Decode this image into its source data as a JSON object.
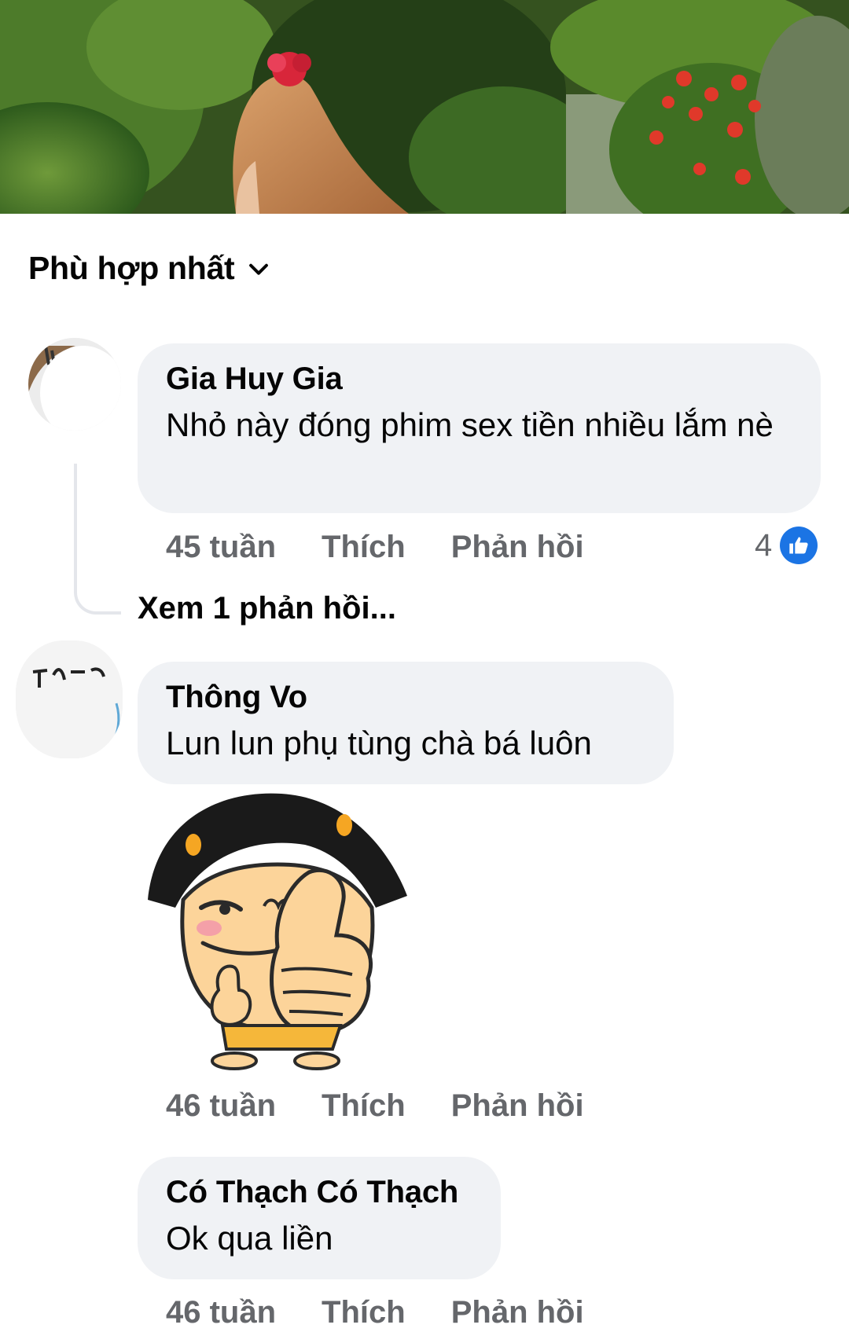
{
  "sort": {
    "label": "Phù hợp nhất"
  },
  "comments": [
    {
      "author": "Gia Huy Gia",
      "text": "Nhỏ này đóng phim sex tiền nhiều lắm nè",
      "time": "45 tuần",
      "like_label": "Thích",
      "reply_label": "Phản hồi",
      "reaction_count": "4",
      "view_replies": "Xem 1 phản hồi..."
    },
    {
      "author": "Thông Vo",
      "text": "Lun lun phụ tùng chà bá luôn",
      "time": "46 tuần",
      "like_label": "Thích",
      "reply_label": "Phản hồi",
      "sticker": "thumbs-up-girl-sticker"
    },
    {
      "author": "Có Thạch Có Thạch",
      "text": "Ok qua liền",
      "time": "46 tuần",
      "like_label": "Thích",
      "reply_label": "Phản hồi"
    }
  ],
  "colors": {
    "bubble": "#f0f2f5",
    "meta_text": "#65676b",
    "like_blue": "#1b74e4",
    "text": "#050505"
  },
  "icons": [
    "chevron-down-icon",
    "like-reaction-icon"
  ]
}
